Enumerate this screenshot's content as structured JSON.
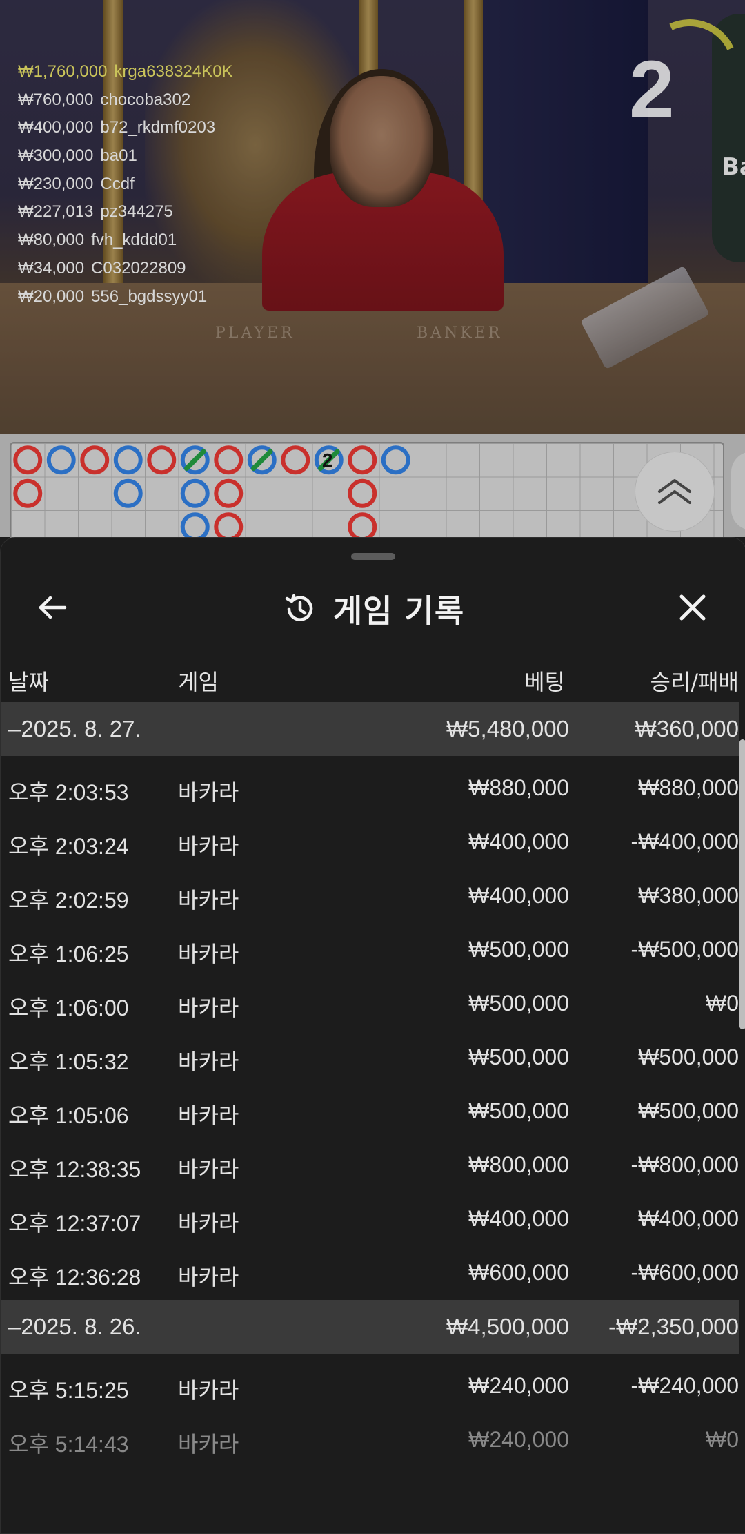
{
  "video": {
    "countdown": "2",
    "side_panel_text": "Ba",
    "table_labels": {
      "player": "PLAYER",
      "banker": "BANKER"
    },
    "winners": [
      {
        "amount": "₩1,760,000",
        "user": "krga638324K0K",
        "top": true
      },
      {
        "amount": "₩760,000",
        "user": "chocoba302"
      },
      {
        "amount": "₩400,000",
        "user": "b72_rkdmf0203"
      },
      {
        "amount": "₩300,000",
        "user": "ba01"
      },
      {
        "amount": "₩230,000",
        "user": "Ccdf"
      },
      {
        "amount": "₩227,013",
        "user": "pz344275"
      },
      {
        "amount": "₩80,000",
        "user": "fvh_kddd01"
      },
      {
        "amount": "₩34,000",
        "user": "C032022809"
      },
      {
        "amount": "₩20,000",
        "user": "556_bgdssyy01"
      }
    ]
  },
  "roadmap": {
    "colors": {
      "banker": "#c9302c",
      "player": "#2b6fc4",
      "tie": "#1f8a3a"
    },
    "tie_count_label": "2"
  },
  "history": {
    "title": "게임 기록",
    "icons": {
      "back": "arrow-left-icon",
      "history": "history-clock-icon",
      "close": "close-icon"
    },
    "columns": {
      "date": "날짜",
      "game": "게임",
      "bet": "베팅",
      "result": "승리/패배"
    },
    "groups": [
      {
        "date": "–2025. 8. 27.",
        "bet_total": "₩5,480,000",
        "result_total": "₩360,000",
        "rows": [
          {
            "time": "오후 2:03:53",
            "game": "바카라",
            "bet": "₩880,000",
            "result": "₩880,000"
          },
          {
            "time": "오후 2:03:24",
            "game": "바카라",
            "bet": "₩400,000",
            "result": "-₩400,000"
          },
          {
            "time": "오후 2:02:59",
            "game": "바카라",
            "bet": "₩400,000",
            "result": "₩380,000"
          },
          {
            "time": "오후 1:06:25",
            "game": "바카라",
            "bet": "₩500,000",
            "result": "-₩500,000"
          },
          {
            "time": "오후 1:06:00",
            "game": "바카라",
            "bet": "₩500,000",
            "result": "₩0"
          },
          {
            "time": "오후 1:05:32",
            "game": "바카라",
            "bet": "₩500,000",
            "result": "₩500,000"
          },
          {
            "time": "오후 1:05:06",
            "game": "바카라",
            "bet": "₩500,000",
            "result": "₩500,000"
          },
          {
            "time": "오후 12:38:35",
            "game": "바카라",
            "bet": "₩800,000",
            "result": "-₩800,000"
          },
          {
            "time": "오후 12:37:07",
            "game": "바카라",
            "bet": "₩400,000",
            "result": "₩400,000"
          },
          {
            "time": "오후 12:36:28",
            "game": "바카라",
            "bet": "₩600,000",
            "result": "-₩600,000"
          }
        ]
      },
      {
        "date": "–2025. 8. 26.",
        "bet_total": "₩4,500,000",
        "result_total": "-₩2,350,000",
        "rows": [
          {
            "time": "오후 5:15:25",
            "game": "바카라",
            "bet": "₩240,000",
            "result": "-₩240,000"
          },
          {
            "time": "오후 5:14:43",
            "game": "바카라",
            "bet": "₩240,000",
            "result": "₩0"
          }
        ]
      }
    ]
  }
}
